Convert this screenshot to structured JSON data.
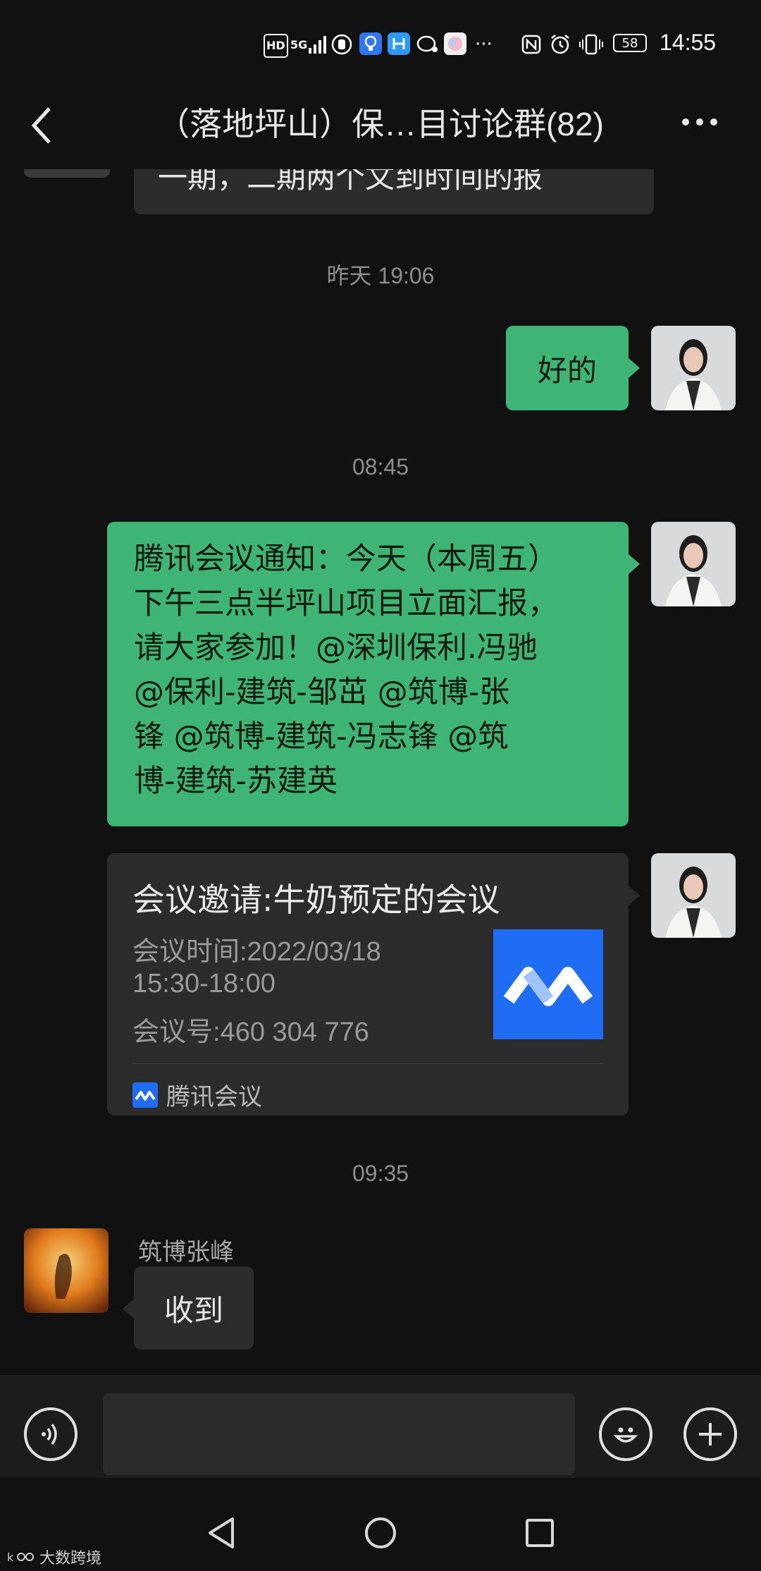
{
  "status_bar": {
    "hd": "HD",
    "network": "5G",
    "battery": "58",
    "time": "14:55",
    "more": "···"
  },
  "header": {
    "back_icon": "chevron-left-icon",
    "title": "（落地坪山）保…目讨论群(82)",
    "more_icon": "ellipsis-icon"
  },
  "messages": {
    "partial_text": "一期，二期两个文到时间的报",
    "ts1": "昨天 19:06",
    "msg_ok": "好的",
    "ts2": "08:45",
    "notice": "腾讯会议通知：今天（本周五）\n下午三点半坪山项目立面汇报，\n请大家参加！@深圳保利.冯驰\n@保利-建筑-邹茁 @筑博-张\n锋 @筑博-建筑-冯志锋 @筑\n博-建筑-苏建英",
    "card": {
      "title": "会议邀请:牛奶预定的会议",
      "time_line1": "会议时间:2022/03/18",
      "time_line2": "15:30-18:00",
      "meeting_no": "会议号:460 304 776",
      "app_name": "腾讯会议"
    },
    "ts3": "09:35",
    "sender": "筑博张峰",
    "msg_received": "收到"
  },
  "input_bar": {
    "voice_icon": "voice-icon",
    "emoji_icon": "emoji-icon",
    "plus_icon": "plus-icon"
  },
  "watermark": "大数跨境",
  "colors": {
    "background": "#111111",
    "bubble_green": "#3eb575",
    "bubble_dark": "#2c2c2c",
    "tencent_blue": "#1f6df5"
  }
}
